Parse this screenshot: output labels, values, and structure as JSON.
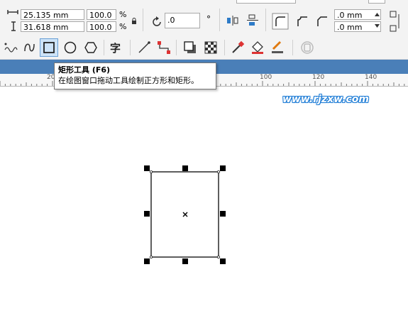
{
  "property_bar": {
    "width_value": "25.135 mm",
    "height_value": "31.618 mm",
    "scale_x": "100.0",
    "scale_y": "100.0",
    "percent_x": "%",
    "percent_y": "%",
    "rotation_value": ".0",
    "corner_radius_top": ".0 mm",
    "corner_radius_bottom": ".0 mm"
  },
  "tooltip": {
    "title": "矩形工具 (F6)",
    "description": "在绘图窗口拖动工具绘制正方形和矩形。"
  },
  "ruler": {
    "labels": [
      "20",
      "100",
      "120",
      "140"
    ]
  },
  "watermark": "www.rjzxw.com",
  "toolbar_icons": [
    "freehand-icon",
    "smart-drawing-icon",
    "rectangle-tool-icon",
    "ellipse-tool-icon",
    "polygon-tool-icon",
    "text-tool-icon",
    "connector-icon",
    "dimension-icon",
    "drop-shadow-icon",
    "transparency-icon",
    "eyedropper-icon",
    "fill-icon",
    "outline-pen-icon",
    "disabled-tool-icon"
  ]
}
